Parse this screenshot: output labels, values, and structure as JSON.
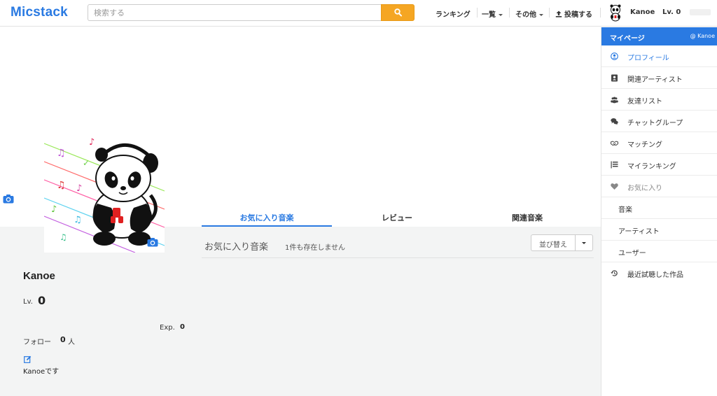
{
  "header": {
    "logo": "Micstack",
    "search_placeholder": "検索する",
    "nav": {
      "ranking": "ランキング",
      "list": "一覧",
      "others": "その他",
      "post": "投稿する"
    },
    "user_name": "Kanoe",
    "user_level": "Lv. 0",
    "accent_color": "#2a7ae2",
    "search_button_color": "#f5a623"
  },
  "profile": {
    "name": "Kanoe",
    "lv_label": "Lv.",
    "lv_value": "0",
    "exp_label": "Exp.",
    "exp_value": "0",
    "follow_label": "フォロー",
    "follow_value": "0",
    "follow_unit": "人",
    "bio": "Kanoeです"
  },
  "tabs": [
    {
      "label": "お気に入り音楽",
      "active": true
    },
    {
      "label": "レビュー",
      "active": false
    },
    {
      "label": "関連音楽",
      "active": false
    }
  ],
  "content": {
    "section_title": "お気に入り音楽",
    "empty_message": "1件も存在しません",
    "sort_label": "並び替え"
  },
  "sidebar": {
    "title": "マイページ",
    "user": "@ Kanoe",
    "items": [
      {
        "label": "プロフィール",
        "icon": "user-circle-icon"
      },
      {
        "label": "関連アーティスト",
        "icon": "contact-card-icon"
      },
      {
        "label": "友達リスト",
        "icon": "users-icon"
      },
      {
        "label": "チャットグループ",
        "icon": "chat-bubbles-icon"
      },
      {
        "label": "マッチング",
        "icon": "handshake-icon"
      },
      {
        "label": "マイランキング",
        "icon": "ranked-list-icon"
      },
      {
        "label": "お気に入り",
        "icon": "heart-icon"
      },
      {
        "label": "音楽"
      },
      {
        "label": "アーティスト"
      },
      {
        "label": "ユーザー"
      },
      {
        "label": "最近試聴した作品",
        "icon": "history-icon"
      }
    ]
  }
}
